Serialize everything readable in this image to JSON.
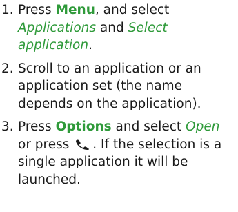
{
  "steps": [
    {
      "number": "1.",
      "t1": "Press ",
      "k1": "Menu",
      "t2": ", and select ",
      "i1": "Applications",
      "t3": " and ",
      "i2": "Select application",
      "t4": "."
    },
    {
      "number": "2.",
      "t1": "Scroll to an application or an application set (the name depends on the application)."
    },
    {
      "number": "3.",
      "t1": "Press ",
      "k1": "Options",
      "t2": " and select ",
      "i1": "Open",
      "t3": " or press ",
      "icon": "call-key-icon",
      "t4": ". If the selection is a single application it will be launched."
    }
  ],
  "colors": {
    "text": "#1a1a1a",
    "keyword": "#2f9a3a"
  }
}
